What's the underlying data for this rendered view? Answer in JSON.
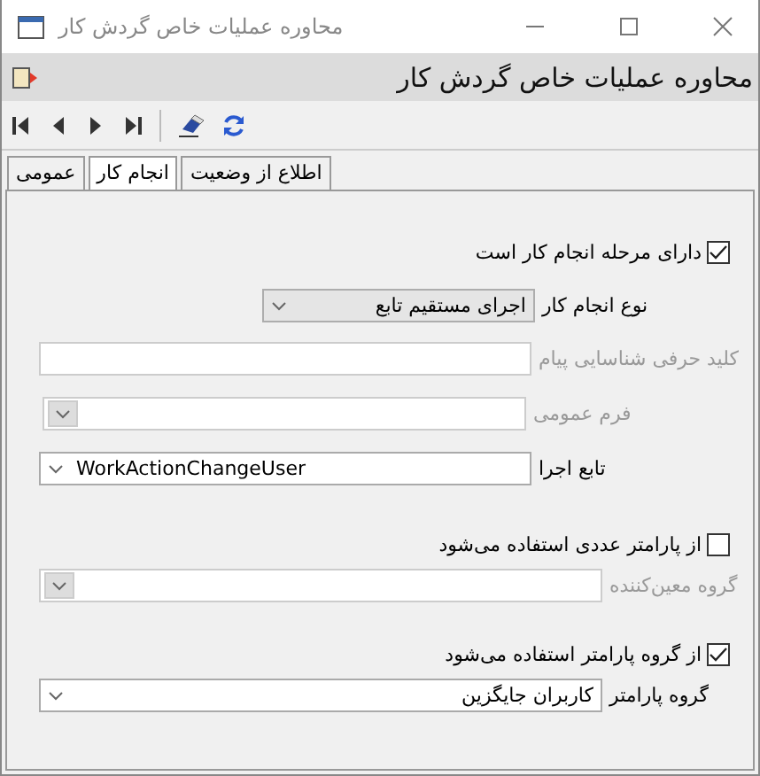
{
  "window": {
    "title": "محاوره عملیات خاص گردش کار"
  },
  "header": {
    "title": "محاوره عملیات خاص گردش کار"
  },
  "tabs": [
    {
      "label": "اطلاع از وضعیت",
      "selected": false
    },
    {
      "label": "انجام کار",
      "selected": true
    },
    {
      "label": "عمومی",
      "selected": false
    }
  ],
  "form": [
    {
      "kind": "checkbox",
      "label": "دارای مرحله انجام کار است",
      "checked": true
    },
    {
      "kind": "dropdown",
      "label": "نوع انجام کار",
      "value": "اجرای مستقیم تابع",
      "disabled": false
    },
    {
      "kind": "field",
      "label": "کلید حرفی شناسایی پیام",
      "disabled": true
    },
    {
      "kind": "combo",
      "label": "فرم عمومی",
      "disabled": true
    },
    {
      "kind": "combo",
      "label": "تابع اجرا",
      "value": "WorkActionChangeUser",
      "disabled": false
    },
    {
      "kind": "checkbox",
      "label": "از پارامتر عددی استفاده می‌شود",
      "checked": false
    },
    {
      "kind": "combo",
      "label": "گروه معین‌کننده",
      "disabled": true
    },
    {
      "kind": "checkbox",
      "label": "از گروه پارامتر استفاده می‌شود",
      "checked": true
    },
    {
      "kind": "combo",
      "label": "گروه پارامتر",
      "value": "کاربران  جایگزین",
      "disabled": false
    }
  ]
}
